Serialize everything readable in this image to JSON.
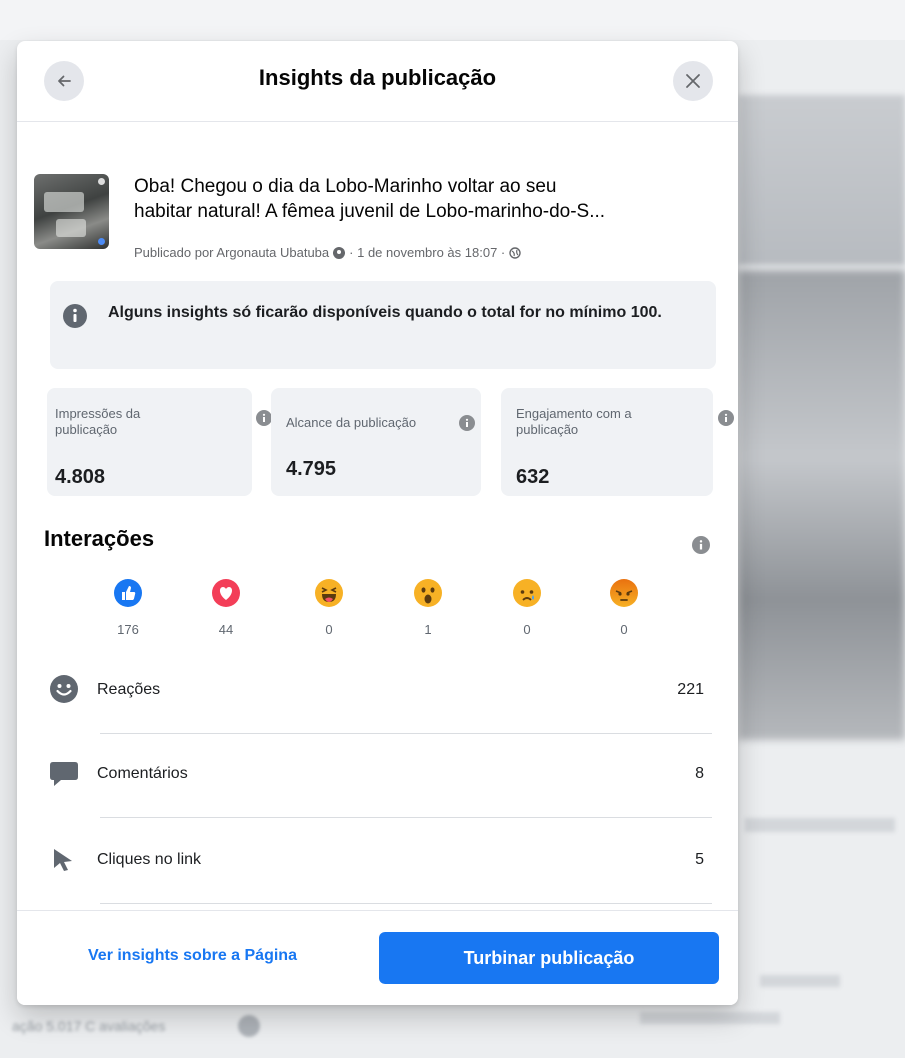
{
  "dialog": {
    "title": "Insights da publicação",
    "back_icon": "arrow-left-icon",
    "close_icon": "close-icon"
  },
  "post": {
    "text_line1": "Oba! Chegou o dia da Lobo-Marinho voltar ao seu",
    "text_line2": "habitar natural! A fêmea juvenil de Lobo-marinho-do-S...",
    "meta_prefix": "Publicado por Argonauta Ubatuba",
    "meta_date": "· 1 de novembro às 18:07 ·"
  },
  "notice": {
    "text": "Alguns insights só ficarão disponíveis quando o total for no mínimo 100."
  },
  "stats": [
    {
      "label": "Impressões da publicação",
      "value": "4.808"
    },
    {
      "label": "Alcance da publicação",
      "value": "4.795"
    },
    {
      "label": "Engajamento com a publicação",
      "value": "632"
    }
  ],
  "interactions": {
    "title": "Interações",
    "reactions": [
      {
        "icon": "like-icon",
        "count": "176"
      },
      {
        "icon": "love-icon",
        "count": "44"
      },
      {
        "icon": "haha-icon",
        "count": "0"
      },
      {
        "icon": "wow-icon",
        "count": "1"
      },
      {
        "icon": "sad-icon",
        "count": "0"
      },
      {
        "icon": "angry-icon",
        "count": "0"
      }
    ],
    "rows": [
      {
        "label": "Reações",
        "value": "221",
        "icon": "smiley-icon"
      },
      {
        "label": "Comentários",
        "value": "8",
        "icon": "comment-icon"
      },
      {
        "label": "Cliques no link",
        "value": "5",
        "icon": "cursor-icon"
      }
    ]
  },
  "footer": {
    "link_label": "Ver insights sobre a Página",
    "button_label": "Turbinar publicação"
  },
  "colors": {
    "accent": "#1877f2",
    "like": "#1877f2",
    "love": "#f33e58",
    "emoji_yellow": "#f7b125",
    "angry": "#e9710f"
  },
  "background": {
    "bottom_text": "ação 5.017 C avaliações"
  }
}
